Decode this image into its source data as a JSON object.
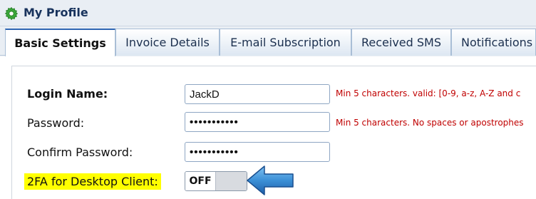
{
  "header": {
    "title": "My Profile",
    "icon": "gear-icon"
  },
  "tabs": [
    {
      "label": "Basic Settings",
      "active": true
    },
    {
      "label": "Invoice Details",
      "active": false
    },
    {
      "label": "E-mail Subscription",
      "active": false
    },
    {
      "label": "Received SMS",
      "active": false
    },
    {
      "label": "Notifications",
      "active": false
    }
  ],
  "form": {
    "login": {
      "label": "Login Name:",
      "value": "JackD",
      "hint": "Min 5 characters. valid: [0-9, a-z, A-Z and c"
    },
    "password": {
      "label": "Password:",
      "value": "•••••••••••",
      "hint": "Min 5 characters. No spaces or apostrophes"
    },
    "confirm": {
      "label": "Confirm Password:",
      "value": "•••••••••••"
    },
    "twofa": {
      "label": "2FA for Desktop Client:",
      "toggle_text": "OFF",
      "state": "off"
    }
  },
  "colors": {
    "highlight": "#ffff00",
    "hint_text": "#c00000",
    "arrow": "#3b8fd6",
    "gear": "#3aa63a"
  }
}
